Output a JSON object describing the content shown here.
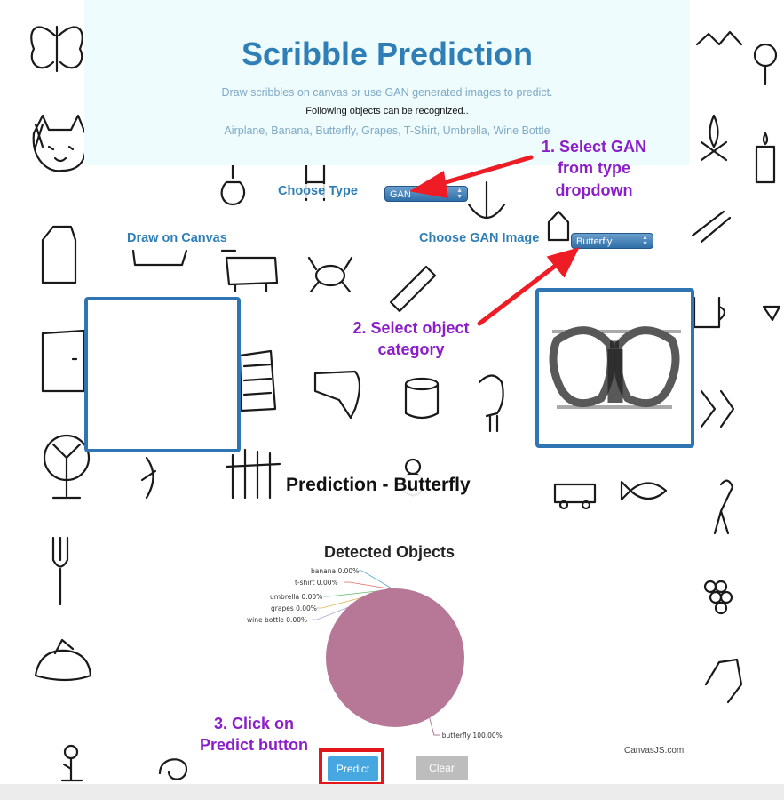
{
  "header": {
    "title": "Scribble Prediction",
    "subtitle": "Draw scribbles on canvas or use GAN generated images to predict.",
    "following_text": "Following objects can be recognized..",
    "objects_list": "Airplane, Banana, Butterfly, Grapes, T-Shirt, Umbrella, Wine Bottle"
  },
  "controls": {
    "choose_type_label": "Choose Type",
    "type_value": "GAN",
    "draw_canvas_label": "Draw on Canvas",
    "choose_gan_label": "Choose GAN Image",
    "gan_value": "Butterfly"
  },
  "prediction": {
    "title": "Prediction - Butterfly"
  },
  "chart_data": {
    "type": "pie",
    "title": "Detected Objects",
    "slices": [
      {
        "label": "banana",
        "value": 0.0,
        "display": "banana 0.00%",
        "color": "#5aa7c9"
      },
      {
        "label": "t-shirt",
        "value": 0.0,
        "display": "t-shirt 0.00%",
        "color": "#e06b6b"
      },
      {
        "label": "umbrella",
        "value": 0.0,
        "display": "umbrella 0.00%",
        "color": "#6cc07a"
      },
      {
        "label": "grapes",
        "value": 0.0,
        "display": "grapes 0.00%",
        "color": "#e0b75b"
      },
      {
        "label": "wine bottle",
        "value": 0.0,
        "display": "wine bottle 0.00%",
        "color": "#a7a7d9"
      },
      {
        "label": "butterfly",
        "value": 100.0,
        "display": "butterfly 100.00%",
        "color": "#b77796"
      }
    ]
  },
  "annotations": {
    "step1": "1. Select GAN from type dropdown",
    "step2": "2. Select object category",
    "step3": "3. Click on Predict button",
    "arrow_color": "#ee1c25",
    "callout_color": "#8b1ec9"
  },
  "buttons": {
    "predict_label": "Predict",
    "clear_label": "Clear"
  },
  "footer": {
    "credit": "CanvasJS.com"
  }
}
